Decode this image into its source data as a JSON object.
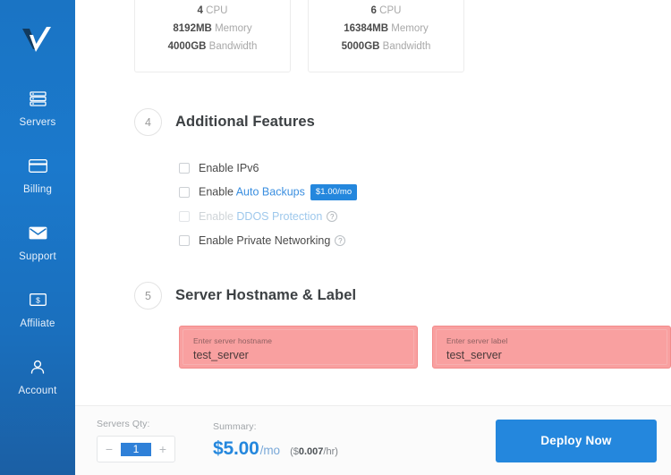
{
  "sidebar": {
    "logo_name": "vultr-logo",
    "items": [
      {
        "label": "Servers",
        "icon": "servers-icon"
      },
      {
        "label": "Billing",
        "icon": "credit-card-icon"
      },
      {
        "label": "Support",
        "icon": "envelope-icon"
      },
      {
        "label": "Affiliate",
        "icon": "dollar-bill-icon"
      },
      {
        "label": "Account",
        "icon": "user-icon"
      }
    ]
  },
  "plans": [
    {
      "cpu_value": "4",
      "cpu_unit": "CPU",
      "memory_value": "8192MB",
      "memory_unit": "Memory",
      "bandwidth_value": "4000GB",
      "bandwidth_unit": "Bandwidth"
    },
    {
      "cpu_value": "6",
      "cpu_unit": "CPU",
      "memory_value": "16384MB",
      "memory_unit": "Memory",
      "bandwidth_value": "5000GB",
      "bandwidth_unit": "Bandwidth"
    }
  ],
  "features_section": {
    "step": "4",
    "title": "Additional Features",
    "rows": [
      {
        "prefix": "Enable IPv6",
        "link": "",
        "suffix": "",
        "checked": false,
        "disabled": false,
        "badge": "",
        "help": false
      },
      {
        "prefix": "Enable ",
        "link": "Auto Backups",
        "suffix": "",
        "checked": false,
        "disabled": false,
        "badge": "$1.00/mo",
        "help": false
      },
      {
        "prefix": "Enable ",
        "link": "DDOS Protection",
        "suffix": "",
        "checked": false,
        "disabled": true,
        "badge": "",
        "help": true
      },
      {
        "prefix": "Enable Private Networking",
        "link": "",
        "suffix": "",
        "checked": false,
        "disabled": false,
        "badge": "",
        "help": true
      }
    ],
    "help_glyph": "?"
  },
  "hostname_section": {
    "step": "5",
    "title": "Server Hostname & Label",
    "hostname_placeholder": "Enter server hostname",
    "hostname_value": "test_server",
    "label_placeholder": "Enter server label",
    "label_value": "test_server"
  },
  "bottom_bar": {
    "qty_label": "Servers Qty:",
    "qty_minus": "−",
    "qty_value": "1",
    "qty_plus": "+",
    "summary_label": "Summary:",
    "price_main": "$5.00",
    "price_per": "/mo",
    "price_hourly_prefix": "($",
    "price_hourly_value": "0.007",
    "price_hourly_suffix": "/hr)",
    "deploy_label": "Deploy Now"
  },
  "colors": {
    "brand_blue": "#2487dd",
    "sidebar_blue": "#1a74c4",
    "error_red": "#f9a0a0",
    "link_blue": "#3b8fe0"
  }
}
